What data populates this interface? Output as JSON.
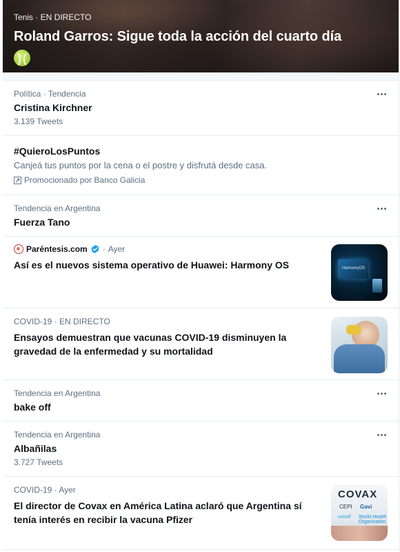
{
  "hero": {
    "meta": "Tenis · EN DIRECTO",
    "title": "Roland Garros: Sigue toda la acción del cuarto día",
    "icon": "tennis-ball-icon"
  },
  "trends": [
    {
      "meta": "Política · Tendencia",
      "title": "Cristina Kirchner",
      "count": "3.139 Tweets"
    },
    {
      "title": "#QuieroLosPuntos",
      "description": "Canjeá tus puntos por la cena o el postre y disfrutá desde casa.",
      "promoted": "Promocionado por Banco Galicia"
    },
    {
      "meta": "Tendencia en Argentina",
      "title": "Fuerza Tano"
    },
    {
      "source": "Paréntesis.com",
      "time": "Ayer",
      "title": "Así es el nuevos sistema operativo de Huawei: Harmony OS",
      "thumb_text": "HarmonyOS"
    },
    {
      "meta": "COVID-19 · EN DIRECTO",
      "title": "Ensayos demuestran que vacunas COVID-19 disminuyen la gravedad de la enfermedad y su mortalidad"
    },
    {
      "meta": "Tendencia en Argentina",
      "title": "bake off"
    },
    {
      "meta": "Tendencia en Argentina",
      "title": "Albañilas",
      "count": "3.727 Tweets"
    },
    {
      "meta": "COVID-19 · Ayer",
      "title": "El director de Covax en América Latina aclaró que Argentina sí tenía interés en recibir la vacuna Pfizer",
      "thumb_logo": "COVAX",
      "thumb_partners": [
        "CEPI",
        "Gavi",
        "unicef",
        "World Health Organization"
      ]
    }
  ],
  "colors": {
    "secondary_text": "#5b7083",
    "primary_text": "#0f1419",
    "divider": "#e6ecf0",
    "verified": "#1da1f2"
  }
}
